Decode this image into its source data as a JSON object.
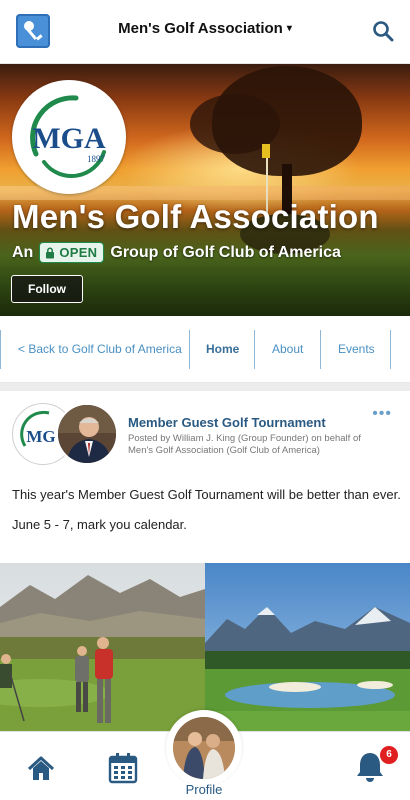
{
  "header": {
    "group_name": "Men's Golf Association",
    "caret": "▾"
  },
  "hero": {
    "logo": {
      "letters": "MGA",
      "year": "1897"
    },
    "title": "Men's Golf Association",
    "subtitle_prefix": "An",
    "badge": "OPEN",
    "subtitle_suffix": "Group of Golf Club of America",
    "follow_label": "Follow"
  },
  "tabs": [
    {
      "label": "< Back to Golf Club of America"
    },
    {
      "label": "Home",
      "active": true
    },
    {
      "label": "About"
    },
    {
      "label": "Events"
    }
  ],
  "post": {
    "title": "Member Guest Golf Tournament",
    "meta": "Posted by William J. King (Group Founder) on behalf of Men's Golf Association (Golf Club of America)",
    "body": [
      "This year's Member Guest Golf Tournament will be better than ever.",
      "June 5 - 7, mark you calendar."
    ],
    "more_icon": "•••"
  },
  "bottom_nav": {
    "profile_label": "Profile",
    "notification_count": "6",
    "icons": [
      "home-icon",
      "calendar-icon",
      "profile-avatar",
      "bell-icon"
    ]
  },
  "colors": {
    "accent": "#2a5a82",
    "link": "#4a90c2",
    "open_green": "#1f7a44",
    "badge_red": "#e02020"
  }
}
